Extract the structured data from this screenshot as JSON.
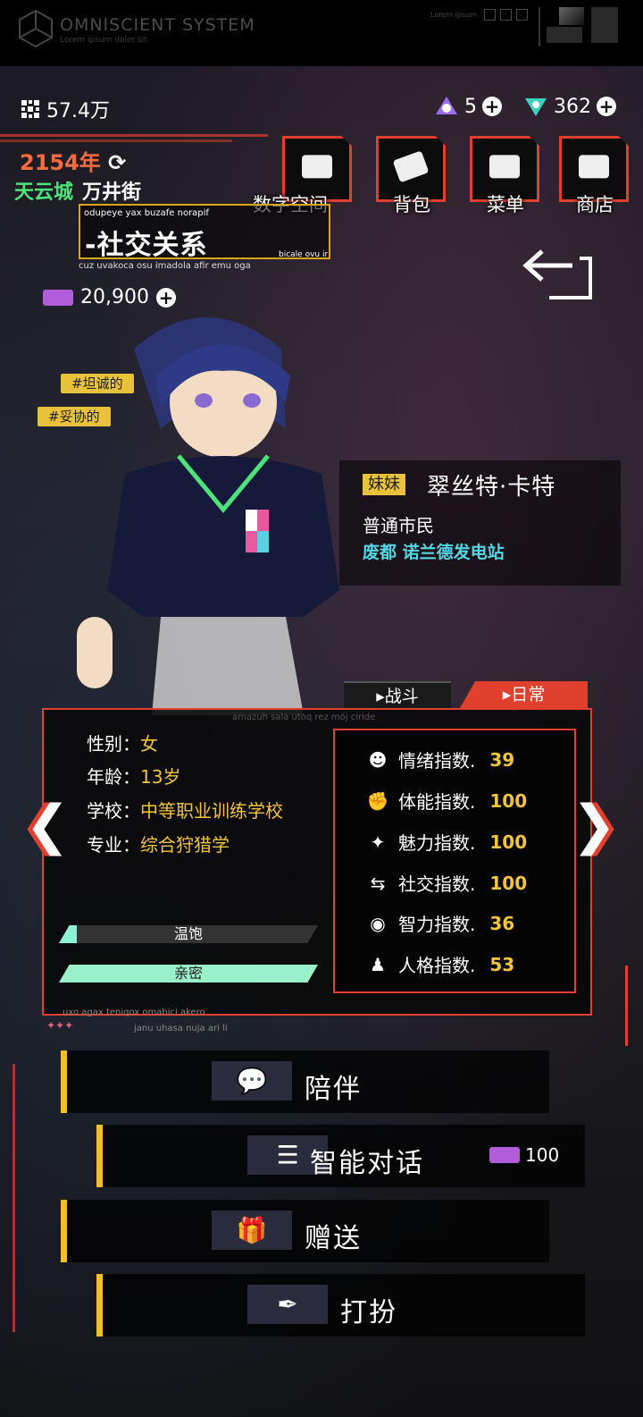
{
  "topbar": {
    "title": "OMNISCIENT  SYSTEM",
    "subtitle": "Lorem ipsum dolor sit",
    "lorem": "Lorem ipsum"
  },
  "resources": {
    "coins": "57.4万",
    "tokens": "5",
    "crystals": "362"
  },
  "location": {
    "year": "2154年",
    "city": "天云城",
    "street": "万井街"
  },
  "nav": {
    "digital_space": "数字空间",
    "bag": "背包",
    "menu": "菜单",
    "shop": "商店"
  },
  "page_title": {
    "top": "odupeye yax buzafe norapif",
    "main": "-社交关系",
    "right": "bicale ovu ir",
    "bottom": "cuz uvakoca osu imadola afir emu oga"
  },
  "currency": {
    "amount": "20,900"
  },
  "tags": [
    "#坦诚的",
    "#妥协的"
  ],
  "character": {
    "relation": "妹妹",
    "name": "翠丝特·卡特",
    "role": "普通市民",
    "location": "废都 诺兰德发电站"
  },
  "tabs": {
    "battle": "战斗",
    "daily": "日常"
  },
  "card": {
    "lorem_top": "amazuh sala utoq rez möj ciride",
    "foot1": "uxo agax teniqox omahici akero",
    "foot2": "janu uhasa nuja ari li",
    "dots": "✦✦✦"
  },
  "profile": [
    {
      "key": "性别：",
      "value": "女"
    },
    {
      "key": "年龄：",
      "value": "13岁"
    },
    {
      "key": "学校：",
      "value": "中等职业训练学校"
    },
    {
      "key": "专业：",
      "value": "综合狩猎学"
    }
  ],
  "bars": {
    "satiety": {
      "label": "温饱",
      "fill": 0.07,
      "color": "#8ff0d8"
    },
    "intimacy": {
      "label": "亲密",
      "fill": 1.0,
      "color": "#9af0c8"
    }
  },
  "stats": [
    {
      "icon": "face-icon",
      "glyph": "☻",
      "label": "情绪指数.",
      "value": "39"
    },
    {
      "icon": "fist-icon",
      "glyph": "✊",
      "label": "体能指数.",
      "value": "100"
    },
    {
      "icon": "sparkle-icon",
      "glyph": "✦",
      "label": "魅力指数.",
      "value": "100"
    },
    {
      "icon": "social-icon",
      "glyph": "⇆",
      "label": "社交指数.",
      "value": "100"
    },
    {
      "icon": "eye-icon",
      "glyph": "◉",
      "label": "智力指数.",
      "value": "36"
    },
    {
      "icon": "person-icon",
      "glyph": "♟",
      "label": "人格指数.",
      "value": "53"
    }
  ],
  "actions": {
    "accompany": "陪伴",
    "chat": "智能对话",
    "chat_cost": "100",
    "gift": "赠送",
    "dress": "打扮"
  },
  "colors": {
    "accent_red": "#e2402f",
    "accent_yellow": "#f2c43b",
    "green": "#4ee37a",
    "cyan": "#55d6e6"
  }
}
